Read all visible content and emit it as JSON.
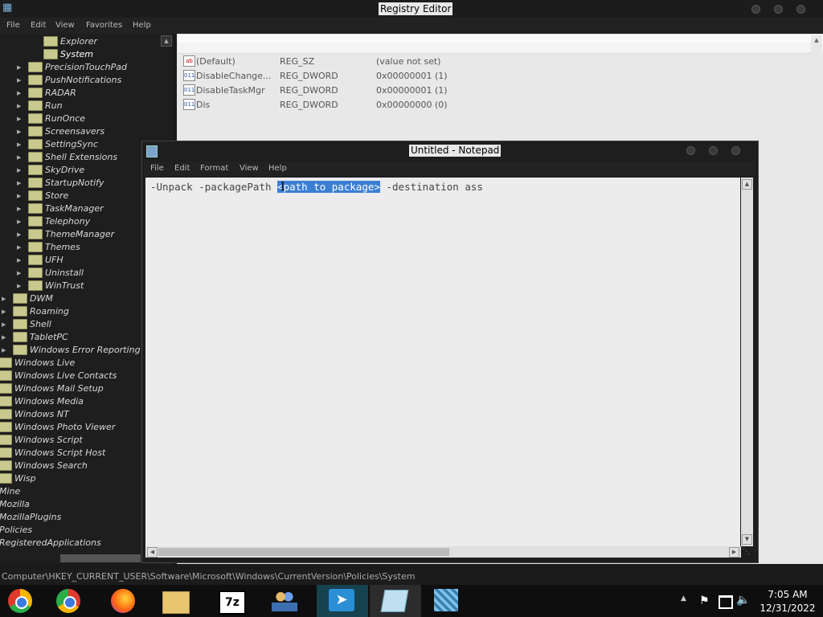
{
  "registry": {
    "title": "Registry Editor",
    "menu": [
      "File",
      "Edit",
      "View",
      "Favorites",
      "Help"
    ],
    "tree": [
      {
        "label": "Explorer",
        "level": 2
      },
      {
        "label": "System",
        "level": 2
      },
      {
        "label": "PrecisionTouchPad",
        "level": 1
      },
      {
        "label": "PushNotifications",
        "level": 1
      },
      {
        "label": "RADAR",
        "level": 1
      },
      {
        "label": "Run",
        "level": 1
      },
      {
        "label": "RunOnce",
        "level": 1
      },
      {
        "label": "Screensavers",
        "level": 1
      },
      {
        "label": "SettingSync",
        "level": 1
      },
      {
        "label": "Shell Extensions",
        "level": 1
      },
      {
        "label": "SkyDrive",
        "level": 1
      },
      {
        "label": "StartupNotify",
        "level": 1
      },
      {
        "label": "Store",
        "level": 1
      },
      {
        "label": "TaskManager",
        "level": 1
      },
      {
        "label": "Telephony",
        "level": 1
      },
      {
        "label": "ThemeManager",
        "level": 1
      },
      {
        "label": "Themes",
        "level": 1
      },
      {
        "label": "UFH",
        "level": 1
      },
      {
        "label": "Uninstall",
        "level": 1
      },
      {
        "label": "WinTrust",
        "level": 1
      },
      {
        "label": "DWM",
        "level": 0
      },
      {
        "label": "Roaming",
        "level": 0
      },
      {
        "label": "Shell",
        "level": 0
      },
      {
        "label": "TabletPC",
        "level": 0
      },
      {
        "label": "Windows Error Reporting",
        "level": 0
      },
      {
        "label": "Windows Live",
        "level": -1
      },
      {
        "label": "Windows Live Contacts",
        "level": -1
      },
      {
        "label": "Windows Mail Setup",
        "level": -1
      },
      {
        "label": "Windows Media",
        "level": -1
      },
      {
        "label": "Windows NT",
        "level": -1
      },
      {
        "label": "Windows Photo Viewer",
        "level": -1
      },
      {
        "label": "Windows Script",
        "level": -1
      },
      {
        "label": "Windows Script Host",
        "level": -1
      },
      {
        "label": "Windows Search",
        "level": -1
      },
      {
        "label": "Wisp",
        "level": -1
      },
      {
        "label": "Mine",
        "level": -2
      },
      {
        "label": "Mozilla",
        "level": -2
      },
      {
        "label": "MozillaPlugins",
        "level": -2
      },
      {
        "label": "Policies",
        "level": -2
      },
      {
        "label": "RegisteredApplications",
        "level": -2
      }
    ],
    "values": [
      {
        "name": "(Default)",
        "type": "REG_SZ",
        "data": "(value not set)",
        "icon": "ab"
      },
      {
        "name": "DisableChange...",
        "type": "REG_DWORD",
        "data": "0x00000001 (1)",
        "icon": "011"
      },
      {
        "name": "DisableTaskMgr",
        "type": "REG_DWORD",
        "data": "0x00000001 (1)",
        "icon": "011"
      },
      {
        "name": "Dis",
        "type": "REG_DWORD",
        "data": "0x00000000 (0)",
        "icon": "011"
      }
    ],
    "status_path": "Computer\\HKEY_CURRENT_USER\\Software\\Microsoft\\Windows\\CurrentVersion\\Policies\\System"
  },
  "notepad": {
    "title": "Untitled - Notepad",
    "menu": [
      "File",
      "Edit",
      "Format",
      "View",
      "Help"
    ],
    "text_before": "-Unpack -packagePath ",
    "text_selected": "<path to package>",
    "text_after": " -destination ass"
  },
  "taskbar": {
    "apps": [
      "chrome-canary-icon",
      "chrome-icon",
      "firefox-icon",
      "file-explorer-icon",
      "7zip-icon",
      "people-icon",
      "remote-app-icon",
      "notepad-icon",
      "registry-editor-icon"
    ],
    "time": "7:05 AM",
    "date": "12/31/2022"
  }
}
